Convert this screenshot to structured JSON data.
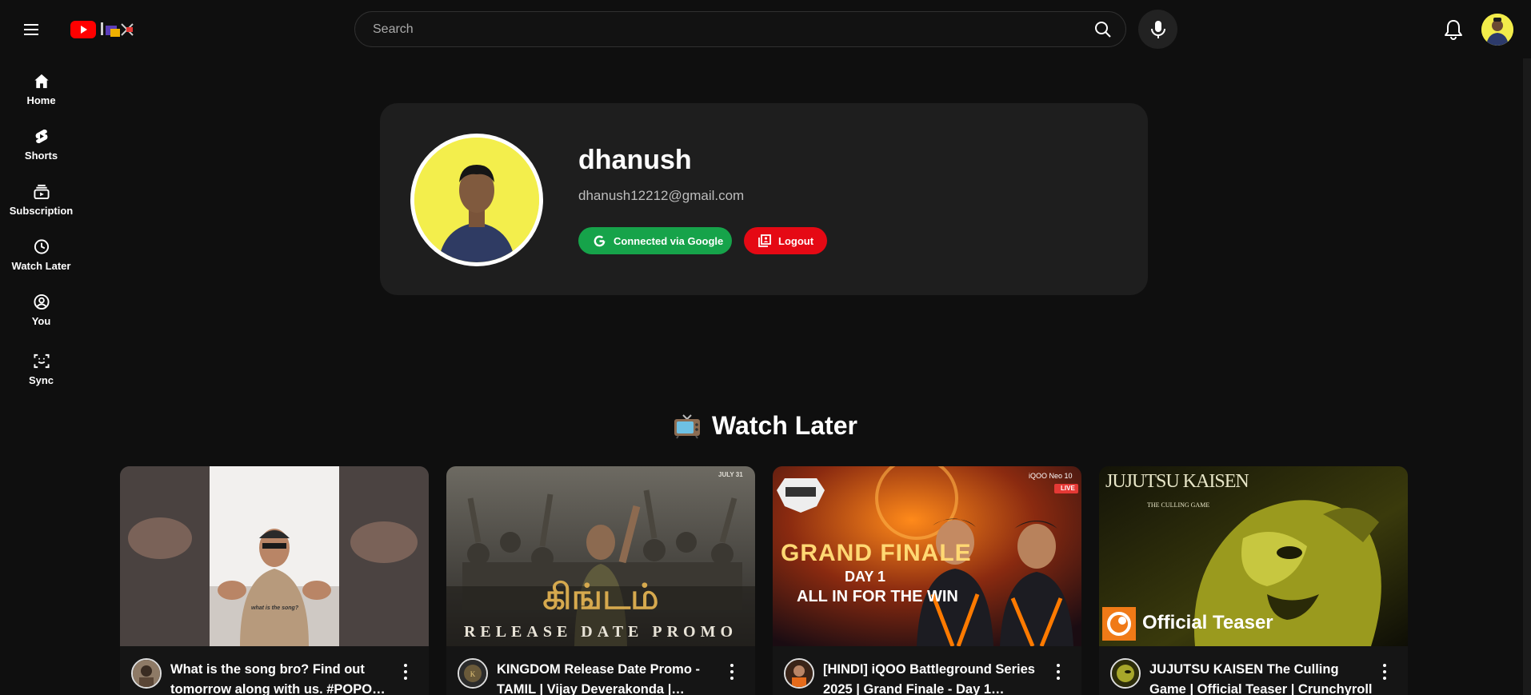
{
  "topbar": {
    "search_placeholder": "Search",
    "accent": "#ff0000"
  },
  "sidebar": {
    "items": [
      {
        "label": "Home",
        "icon": "home-icon"
      },
      {
        "label": "Shorts",
        "icon": "shorts-icon"
      },
      {
        "label": "Subscription",
        "icon": "subscriptions-icon"
      },
      {
        "label": "Watch Later",
        "icon": "clock-icon"
      },
      {
        "label": "You",
        "icon": "user-circle-icon"
      },
      {
        "label": "Sync",
        "icon": "sync-scan-icon"
      }
    ]
  },
  "profile": {
    "name": "dhanush",
    "email": "dhanush12212@gmail.com",
    "google_button": "Connected via Google",
    "logout_button": "Logout",
    "google_color": "#16a34a",
    "logout_color": "#e50914"
  },
  "watch_later": {
    "heading": "Watch Later",
    "heading_icon": "tv-icon",
    "videos": [
      {
        "title": "What is the song bro? Find out tomorrow along with us. #POPO…",
        "thumb_caption": "what is the song?"
      },
      {
        "title": "KINGDOM Release Date Promo - TAMIL | Vijay Deverakonda |…",
        "thumb_text": "RELEASE DATE PROMO",
        "thumb_date": "JULY 31"
      },
      {
        "title": "[HINDI] iQOO Battleground Series 2025 | Grand Finale - Day 1…",
        "thumb_line1": "GRAND FINALE",
        "thumb_line2": "DAY 1",
        "thumb_line3": "ALL IN FOR THE WIN",
        "thumb_brand": "iQOO Neo 10",
        "thumb_live": "LIVE"
      },
      {
        "title": "JUJUTSU KAISEN The Culling Game | Official Teaser | Crunchyroll",
        "thumb_text": "Official Teaser",
        "thumb_logo": "JUJUTSU KAISEN",
        "thumb_sub": "THE CULLING GAME"
      }
    ]
  }
}
